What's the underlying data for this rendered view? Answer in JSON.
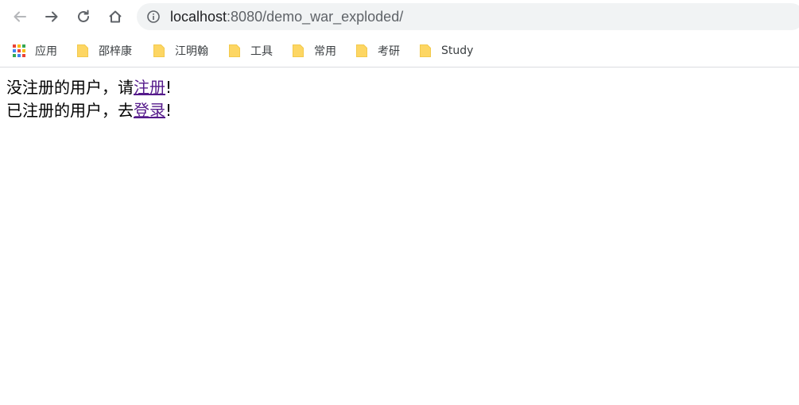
{
  "browser": {
    "url_host": "localhost",
    "url_path": ":8080/demo_war_exploded/"
  },
  "bookmarks": [
    {
      "label": "应用",
      "icon": "apps-grid-icon"
    },
    {
      "label": "邵梓康",
      "icon": "folder-icon"
    },
    {
      "label": "江明翰",
      "icon": "folder-icon"
    },
    {
      "label": "工具",
      "icon": "folder-icon"
    },
    {
      "label": "常用",
      "icon": "folder-icon"
    },
    {
      "label": "考研",
      "icon": "folder-icon"
    },
    {
      "label": "Study",
      "icon": "folder-icon"
    }
  ],
  "page": {
    "line1_prefix": "没注册的用户，请",
    "line1_link": "注册",
    "line1_suffix": "!",
    "line2_prefix": "已注册的用户，去",
    "line2_link": "登录",
    "line2_suffix": "!"
  },
  "colors": {
    "link_visited": "#551a8b",
    "omnibox_bg": "#f1f3f4",
    "folder": "#fdd663"
  }
}
